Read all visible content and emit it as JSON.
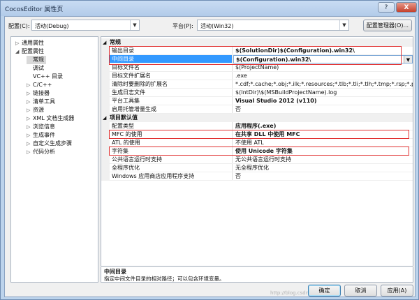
{
  "window": {
    "title": "CocosEditor 属性页",
    "help_label": "?",
    "close_label": "X"
  },
  "topbar": {
    "config_label": "配置(C):",
    "config_value": "活动(Debug)",
    "platform_label": "平台(P):",
    "platform_value": "活动(Win32)",
    "config_manager_label": "配置管理器(O)..."
  },
  "tree": {
    "items": [
      {
        "label": "通用属性",
        "toggle": "▷"
      },
      {
        "label": "配置属性",
        "toggle": "◢"
      },
      {
        "label": "常规",
        "toggle": ""
      },
      {
        "label": "调试",
        "toggle": ""
      },
      {
        "label": "VC++ 目录",
        "toggle": ""
      },
      {
        "label": "C/C++",
        "toggle": "▷"
      },
      {
        "label": "链接器",
        "toggle": "▷"
      },
      {
        "label": "清单工具",
        "toggle": "▷"
      },
      {
        "label": "资源",
        "toggle": "▷"
      },
      {
        "label": "XML 文档生成器",
        "toggle": "▷"
      },
      {
        "label": "浏览信息",
        "toggle": "▷"
      },
      {
        "label": "生成事件",
        "toggle": "▷"
      },
      {
        "label": "自定义生成步骤",
        "toggle": "▷"
      },
      {
        "label": "代码分析",
        "toggle": "▷"
      }
    ]
  },
  "grid": {
    "categories": [
      {
        "label": "常规",
        "toggle": "◢"
      },
      {
        "label": "项目默认值",
        "toggle": "◢"
      }
    ],
    "rows_general": [
      {
        "name": "输出目录",
        "value": "$(SolutionDir)$(Configuration).win32\\"
      },
      {
        "name": "中间目录",
        "value": "$(Configuration).win32\\",
        "arrow": "▼"
      },
      {
        "name": "目标文件名",
        "value": "$(ProjectName)"
      },
      {
        "name": "目标文件扩展名",
        "value": ".exe"
      },
      {
        "name": "清除时要删除的扩展名",
        "value": "*.cdf;*.cache;*.obj;*.ilk;*.resources;*.tlb;*.tli;*.tlh;*.tmp;*.rsp;*.pgc;*.pgd;*"
      },
      {
        "name": "生成日志文件",
        "value": "$(IntDir)\\$(MSBuildProjectName).log"
      },
      {
        "name": "平台工具集",
        "value": "Visual Studio 2012 (v110)"
      },
      {
        "name": "启用托管增量生成",
        "value": "否"
      }
    ],
    "rows_defaults": [
      {
        "name": "配置类型",
        "value": "应用程序(.exe)"
      },
      {
        "name": "MFC 的使用",
        "value": "在共享 DLL 中使用 MFC"
      },
      {
        "name": "ATL 的使用",
        "value": "不使用 ATL"
      },
      {
        "name": "字符集",
        "value": "使用 Unicode 字符集"
      },
      {
        "name": "公共语言运行时支持",
        "value": "无公共语言运行时支持"
      },
      {
        "name": "全程序优化",
        "value": "无全程序优化"
      },
      {
        "name": "Windows 应用商店应用程序支持",
        "value": "否"
      }
    ]
  },
  "description": {
    "title": "中间目录",
    "text": "指定中间文件目录的相对路径；可以包含环境变量。"
  },
  "footer": {
    "ok_label": "确定",
    "cancel_label": "取消",
    "apply_label": "应用(A)"
  },
  "watermark": "http://blog.csdn.net/",
  "colors": {
    "selection": "#3399ff",
    "highlight_box": "#e03030",
    "title_bar": "#b2cbe9"
  }
}
